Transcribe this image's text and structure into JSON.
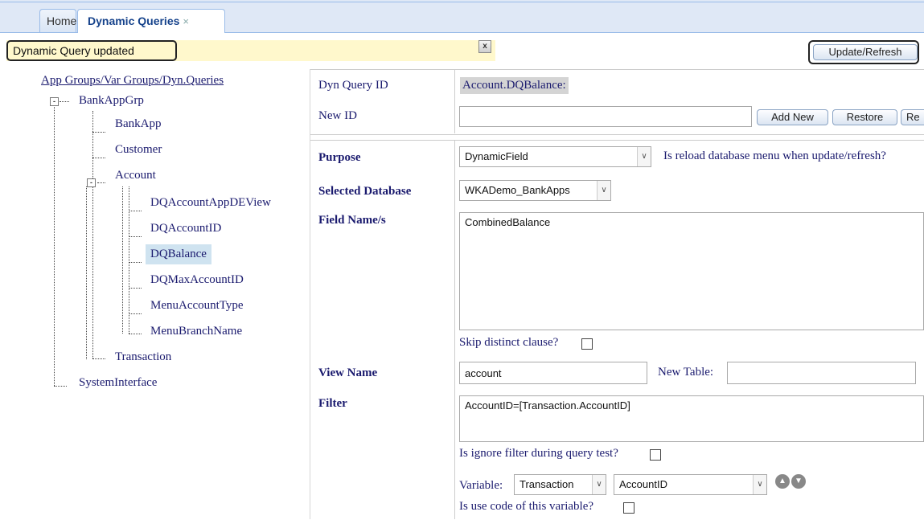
{
  "tabs": [
    {
      "label": "Home"
    },
    {
      "label": "Dynamic Queries",
      "close": "×"
    }
  ],
  "status": {
    "message": "Dynamic Query updated",
    "close": "x"
  },
  "toolbar": {
    "update_label": "Update/Refresh"
  },
  "tree": {
    "root": "App Groups/Var Groups/Dyn.Queries",
    "group": "BankAppGrp",
    "items": {
      "bankapp": "BankApp",
      "customer": "Customer",
      "account": "Account",
      "dq_appdeview": "DQAccountAppDEView",
      "dq_accountid": "DQAccountID",
      "dq_balance": "DQBalance",
      "dq_maxaccountid": "DQMaxAccountID",
      "menu_accounttype": "MenuAccountType",
      "menu_branchname": "MenuBranchName",
      "transaction": "Transaction",
      "systeminterface": "SystemInterface"
    },
    "toggle_collapse": "-"
  },
  "form": {
    "dyn_query_id_label": "Dyn Query ID",
    "dyn_query_id_value": "Account.DQBalance:",
    "new_id_label": "New ID",
    "new_id_value": "",
    "add_new_label": "Add New",
    "restore_label": "Restore",
    "re_label": "Re",
    "purpose_label": "Purpose",
    "purpose_value": "DynamicField",
    "reload_label": "Is reload database menu when update/refresh?",
    "selected_db_label": "Selected Database",
    "selected_db_value": "WKADemo_BankApps",
    "field_names_label": "Field Name/s",
    "field_names_value": "CombinedBalance",
    "skip_distinct_label": "Skip distinct clause?",
    "view_name_label": "View Name",
    "view_name_value": "account",
    "new_table_label": "New Table:",
    "new_table_value": "",
    "filter_label": "Filter",
    "filter_value": "AccountID=[Transaction.AccountID]",
    "ignore_filter_label": "Is ignore filter during query test?",
    "variable_label": "Variable:",
    "variable_group_value": "Transaction",
    "variable_value": "AccountID",
    "use_code_label": "Is use code of this variable?",
    "dropdown_arrow": "∨",
    "move_up": "▲",
    "move_down": "▼"
  }
}
